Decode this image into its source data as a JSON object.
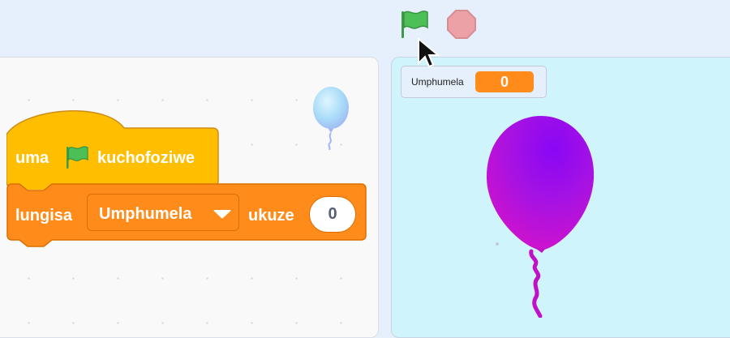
{
  "toolbar": {
    "green_flag_icon": "green-flag-icon",
    "stop_icon": "stop-icon",
    "colors": {
      "flag": "#4cbf56",
      "stop": "#ec9c9c"
    }
  },
  "code_area": {
    "sprite_thumbnail": "balloon-sprite-icon",
    "hat_block": {
      "word_before_flag": "uma",
      "word_after_flag": "kuchofoziwe",
      "color": "#ffbf00"
    },
    "set_block": {
      "label": "lungisa",
      "variable": "Umphumela",
      "to_label": "ukuze",
      "value": "0",
      "color": "#ff8c1a"
    }
  },
  "stage": {
    "monitor": {
      "label": "Umphumela",
      "value": "0"
    },
    "sprite": "balloon",
    "colors": {
      "background": "#cff4fc",
      "balloon": "#b21dd9"
    }
  }
}
